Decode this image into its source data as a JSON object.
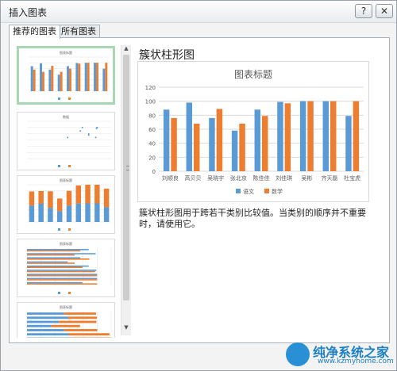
{
  "window": {
    "title": "插入图表",
    "help_label": "?",
    "close_label": "✕"
  },
  "tabs": [
    {
      "label": "推荐的图表",
      "selected": true
    },
    {
      "label": "所有图表",
      "selected": false
    }
  ],
  "thumbnails": [
    {
      "title": "图表标题",
      "kind": "clustered-column",
      "selected": true
    },
    {
      "title": "数据",
      "kind": "scatter",
      "selected": false
    },
    {
      "title": "图表标题",
      "kind": "stacked-column",
      "selected": false
    },
    {
      "title": "图表标题",
      "kind": "clustered-bar",
      "selected": false
    },
    {
      "title": "图表标题",
      "kind": "stacked-bar",
      "selected": false
    }
  ],
  "detail": {
    "title": "簇状柱形图",
    "description": "簇状柱形图用于跨若干类别比较值。当类别的顺序并不重要时，请使用它。"
  },
  "colors": {
    "blue": "#5b9bd5",
    "orange": "#ed7d31",
    "selected_border": "#a6d9b3"
  },
  "chart_data": {
    "type": "bar",
    "title": "图表标题",
    "categories": [
      "刘顺良",
      "高贝贝",
      "吴晓宇",
      "张北京",
      "陈佳佳",
      "刘佳琪",
      "吴彬",
      "齐天磊",
      "杜宝虎"
    ],
    "series": [
      {
        "name": "语文",
        "values": [
          88,
          98,
          76,
          58,
          88,
          99,
          100,
          100,
          79
        ]
      },
      {
        "name": "数学",
        "values": [
          76,
          68,
          89,
          68,
          79,
          97,
          100,
          100,
          100
        ]
      }
    ],
    "ylim": [
      0,
      120
    ],
    "yticks": [
      0,
      20,
      40,
      60,
      80,
      100,
      120
    ],
    "grid": true,
    "legend": "bottom"
  },
  "watermark": {
    "text": "纯净系统之家",
    "url": "www.kzmyhome.com"
  }
}
